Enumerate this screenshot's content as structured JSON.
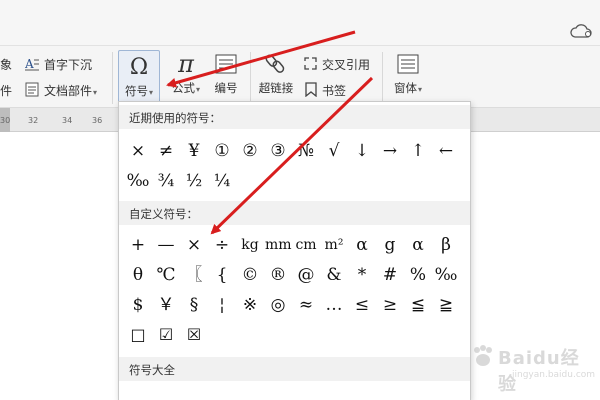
{
  "ribbon": {
    "frag_xiang": "象",
    "shouzi_xiachen": "首字下沉",
    "frag_jian": "件",
    "wendang_bujian": "文档部件",
    "fuhao": "符号",
    "gongshi": "公式",
    "bianhao": "编号",
    "chaolianjie": "超链接",
    "jiaocha_yinyong": "交叉引用",
    "shuqian": "书签",
    "chuangti": "窗体",
    "fuhao_icon": "Ω",
    "gongshi_icon": "π"
  },
  "ruler": {
    "ticks": [
      "30",
      "32",
      "34",
      "36"
    ]
  },
  "panel": {
    "recent_title": "近期使用的符号：",
    "recent_row1": [
      "×",
      "≠",
      "¥",
      "①",
      "②",
      "③",
      "№",
      "√",
      "↓",
      "→",
      "↑",
      "←"
    ],
    "recent_row2": [
      "‰",
      "¾",
      "½",
      "¼"
    ],
    "custom_title": "自定义符号：",
    "custom_row1": [
      "+",
      "—",
      "×",
      "÷",
      "kg",
      "mm",
      "cm",
      "m²",
      "α",
      "g",
      "α",
      "β"
    ],
    "custom_row2": [
      "θ",
      "℃",
      "〖",
      "{",
      "©",
      "®",
      "@",
      "&",
      "*",
      "#",
      "%",
      "‰"
    ],
    "custom_row3": [
      "$",
      "￥",
      "§",
      "¦",
      "※",
      "◎",
      "≈",
      "…",
      "≤",
      "≥",
      "≦",
      "≧"
    ],
    "custom_row4": [
      "□",
      "☑",
      "☒"
    ],
    "all_title": "符号大全"
  },
  "watermark": {
    "brand": "Baidu经验",
    "url": "jingyan.baidu.com"
  },
  "colors": {
    "arrow": "#d81e1e",
    "highlight": "#e9eef6"
  }
}
